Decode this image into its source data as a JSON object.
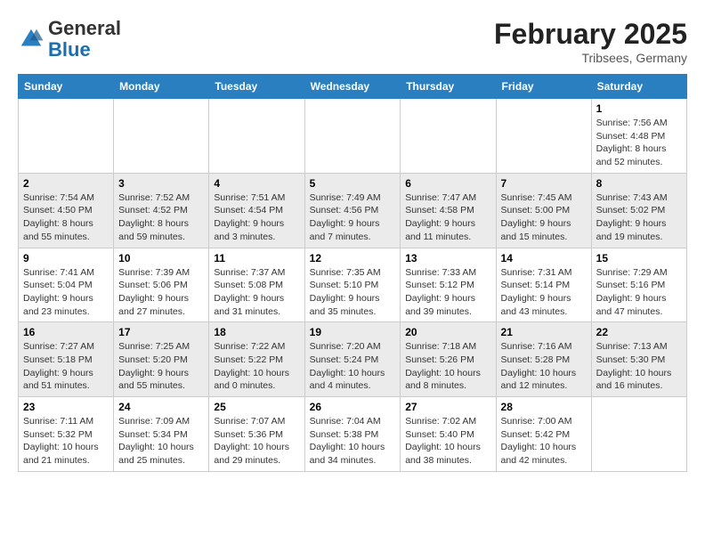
{
  "header": {
    "logo_general": "General",
    "logo_blue": "Blue",
    "month_title": "February 2025",
    "location": "Tribsees, Germany"
  },
  "weekdays": [
    "Sunday",
    "Monday",
    "Tuesday",
    "Wednesday",
    "Thursday",
    "Friday",
    "Saturday"
  ],
  "weeks": [
    [
      {
        "day": "",
        "info": ""
      },
      {
        "day": "",
        "info": ""
      },
      {
        "day": "",
        "info": ""
      },
      {
        "day": "",
        "info": ""
      },
      {
        "day": "",
        "info": ""
      },
      {
        "day": "",
        "info": ""
      },
      {
        "day": "1",
        "info": "Sunrise: 7:56 AM\nSunset: 4:48 PM\nDaylight: 8 hours\nand 52 minutes."
      }
    ],
    [
      {
        "day": "2",
        "info": "Sunrise: 7:54 AM\nSunset: 4:50 PM\nDaylight: 8 hours\nand 55 minutes."
      },
      {
        "day": "3",
        "info": "Sunrise: 7:52 AM\nSunset: 4:52 PM\nDaylight: 8 hours\nand 59 minutes."
      },
      {
        "day": "4",
        "info": "Sunrise: 7:51 AM\nSunset: 4:54 PM\nDaylight: 9 hours\nand 3 minutes."
      },
      {
        "day": "5",
        "info": "Sunrise: 7:49 AM\nSunset: 4:56 PM\nDaylight: 9 hours\nand 7 minutes."
      },
      {
        "day": "6",
        "info": "Sunrise: 7:47 AM\nSunset: 4:58 PM\nDaylight: 9 hours\nand 11 minutes."
      },
      {
        "day": "7",
        "info": "Sunrise: 7:45 AM\nSunset: 5:00 PM\nDaylight: 9 hours\nand 15 minutes."
      },
      {
        "day": "8",
        "info": "Sunrise: 7:43 AM\nSunset: 5:02 PM\nDaylight: 9 hours\nand 19 minutes."
      }
    ],
    [
      {
        "day": "9",
        "info": "Sunrise: 7:41 AM\nSunset: 5:04 PM\nDaylight: 9 hours\nand 23 minutes."
      },
      {
        "day": "10",
        "info": "Sunrise: 7:39 AM\nSunset: 5:06 PM\nDaylight: 9 hours\nand 27 minutes."
      },
      {
        "day": "11",
        "info": "Sunrise: 7:37 AM\nSunset: 5:08 PM\nDaylight: 9 hours\nand 31 minutes."
      },
      {
        "day": "12",
        "info": "Sunrise: 7:35 AM\nSunset: 5:10 PM\nDaylight: 9 hours\nand 35 minutes."
      },
      {
        "day": "13",
        "info": "Sunrise: 7:33 AM\nSunset: 5:12 PM\nDaylight: 9 hours\nand 39 minutes."
      },
      {
        "day": "14",
        "info": "Sunrise: 7:31 AM\nSunset: 5:14 PM\nDaylight: 9 hours\nand 43 minutes."
      },
      {
        "day": "15",
        "info": "Sunrise: 7:29 AM\nSunset: 5:16 PM\nDaylight: 9 hours\nand 47 minutes."
      }
    ],
    [
      {
        "day": "16",
        "info": "Sunrise: 7:27 AM\nSunset: 5:18 PM\nDaylight: 9 hours\nand 51 minutes."
      },
      {
        "day": "17",
        "info": "Sunrise: 7:25 AM\nSunset: 5:20 PM\nDaylight: 9 hours\nand 55 minutes."
      },
      {
        "day": "18",
        "info": "Sunrise: 7:22 AM\nSunset: 5:22 PM\nDaylight: 10 hours\nand 0 minutes."
      },
      {
        "day": "19",
        "info": "Sunrise: 7:20 AM\nSunset: 5:24 PM\nDaylight: 10 hours\nand 4 minutes."
      },
      {
        "day": "20",
        "info": "Sunrise: 7:18 AM\nSunset: 5:26 PM\nDaylight: 10 hours\nand 8 minutes."
      },
      {
        "day": "21",
        "info": "Sunrise: 7:16 AM\nSunset: 5:28 PM\nDaylight: 10 hours\nand 12 minutes."
      },
      {
        "day": "22",
        "info": "Sunrise: 7:13 AM\nSunset: 5:30 PM\nDaylight: 10 hours\nand 16 minutes."
      }
    ],
    [
      {
        "day": "23",
        "info": "Sunrise: 7:11 AM\nSunset: 5:32 PM\nDaylight: 10 hours\nand 21 minutes."
      },
      {
        "day": "24",
        "info": "Sunrise: 7:09 AM\nSunset: 5:34 PM\nDaylight: 10 hours\nand 25 minutes."
      },
      {
        "day": "25",
        "info": "Sunrise: 7:07 AM\nSunset: 5:36 PM\nDaylight: 10 hours\nand 29 minutes."
      },
      {
        "day": "26",
        "info": "Sunrise: 7:04 AM\nSunset: 5:38 PM\nDaylight: 10 hours\nand 34 minutes."
      },
      {
        "day": "27",
        "info": "Sunrise: 7:02 AM\nSunset: 5:40 PM\nDaylight: 10 hours\nand 38 minutes."
      },
      {
        "day": "28",
        "info": "Sunrise: 7:00 AM\nSunset: 5:42 PM\nDaylight: 10 hours\nand 42 minutes."
      },
      {
        "day": "",
        "info": ""
      }
    ]
  ]
}
